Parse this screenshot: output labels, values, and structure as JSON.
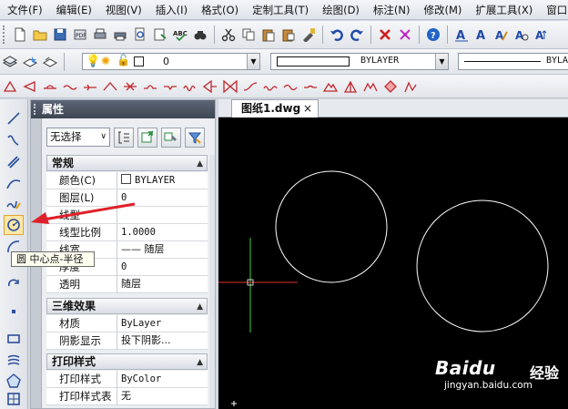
{
  "menu": [
    "文件(F)",
    "编辑(E)",
    "视图(V)",
    "插入(I)",
    "格式(O)",
    "定制工具(T)",
    "绘图(D)",
    "标注(N)",
    "修改(M)",
    "扩展工具(X)",
    "窗口"
  ],
  "toolbar2": {
    "layer_value": "0",
    "linetype_value": "BYLAYER",
    "lineweight_value": "BYLA"
  },
  "panel": {
    "title": "属性",
    "selection": "无选择",
    "sections": {
      "general": "常规",
      "three_d": "三维效果",
      "print_style": "打印样式"
    },
    "general_rows": [
      {
        "key": "颜色(C)",
        "value": "BYLAYER"
      },
      {
        "key": "图层(L)",
        "value": "0"
      },
      {
        "key": "线型",
        "value": ""
      },
      {
        "key": "线型比例",
        "value": "1.0000"
      },
      {
        "key": "线宽",
        "value": "—— 随层"
      },
      {
        "key": "厚度",
        "value": "0"
      },
      {
        "key": "透明",
        "value": "随层"
      }
    ],
    "three_d_rows": [
      {
        "key": "材质",
        "value": "ByLayer"
      },
      {
        "key": "阴影显示",
        "value": "投下阴影..."
      }
    ],
    "print_rows": [
      {
        "key": "打印样式",
        "value": "ByColor"
      },
      {
        "key": "打印样式表",
        "value": "无"
      }
    ]
  },
  "document_tab": {
    "label": "图纸1.dwg",
    "close": "×"
  },
  "tooltip": "圆 中心点-半径",
  "watermark": {
    "brand": "Baidu",
    "sub": "经验",
    "url": "jingyan.baidu.com"
  },
  "colors": {
    "arrow": "#e0202a",
    "canvas": "#000000",
    "panel_header": "#4a5260"
  }
}
